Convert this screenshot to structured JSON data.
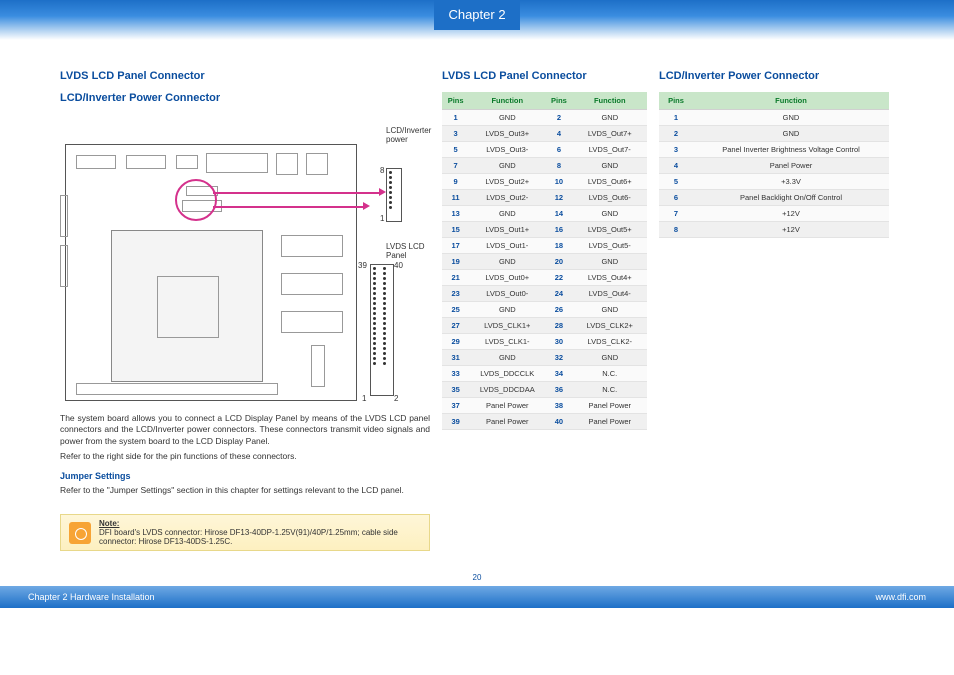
{
  "header": {
    "chapter_tab": "Chapter 2"
  },
  "left": {
    "title1": "LVDS LCD Panel Connector",
    "title2": "LCD/Inverter Power Connector",
    "diagram": {
      "label_inverter": "LCD/Inverter power",
      "label_lvds": "LVDS LCD Panel",
      "pin8": "8",
      "pin1a": "1",
      "pin39": "39",
      "pin40": "40",
      "pin1b": "1",
      "pin2": "2"
    },
    "para1": "The system board allows you to connect a LCD Display Panel by means of the LVDS LCD panel connectors and the LCD/Inverter power connectors. These connectors transmit video signals and power from the system board to the LCD Display Panel.",
    "para2": "Refer to the right side for the pin functions of these connectors.",
    "jumper_head": "Jumper Settings",
    "para3": "Refer to the \"Jumper Settings\" section in this chapter for settings relevant to the LCD panel.",
    "note": {
      "head": "Note:",
      "body": "DFI board's LVDS connector: Hirose DF13-40DP-1.25V(91)/40P/1.25mm; cable side connector: Hirose DF13-40DS-1.25C."
    }
  },
  "mid": {
    "title": "LVDS LCD Panel Connector",
    "headers": [
      "Pins",
      "Function",
      "Pins",
      "Function"
    ],
    "rows": [
      [
        "1",
        "GND",
        "2",
        "GND"
      ],
      [
        "3",
        "LVDS_Out3+",
        "4",
        "LVDS_Out7+"
      ],
      [
        "5",
        "LVDS_Out3-",
        "6",
        "LVDS_Out7-"
      ],
      [
        "7",
        "GND",
        "8",
        "GND"
      ],
      [
        "9",
        "LVDS_Out2+",
        "10",
        "LVDS_Out6+"
      ],
      [
        "11",
        "LVDS_Out2-",
        "12",
        "LVDS_Out6-"
      ],
      [
        "13",
        "GND",
        "14",
        "GND"
      ],
      [
        "15",
        "LVDS_Out1+",
        "16",
        "LVDS_Out5+"
      ],
      [
        "17",
        "LVDS_Out1-",
        "18",
        "LVDS_Out5-"
      ],
      [
        "19",
        "GND",
        "20",
        "GND"
      ],
      [
        "21",
        "LVDS_Out0+",
        "22",
        "LVDS_Out4+"
      ],
      [
        "23",
        "LVDS_Out0-",
        "24",
        "LVDS_Out4-"
      ],
      [
        "25",
        "GND",
        "26",
        "GND"
      ],
      [
        "27",
        "LVDS_CLK1+",
        "28",
        "LVDS_CLK2+"
      ],
      [
        "29",
        "LVDS_CLK1-",
        "30",
        "LVDS_CLK2-"
      ],
      [
        "31",
        "GND",
        "32",
        "GND"
      ],
      [
        "33",
        "LVDS_DDCCLK",
        "34",
        "N.C."
      ],
      [
        "35",
        "LVDS_DDCDAA",
        "36",
        "N.C."
      ],
      [
        "37",
        "Panel Power",
        "38",
        "Panel Power"
      ],
      [
        "39",
        "Panel Power",
        "40",
        "Panel Power"
      ]
    ]
  },
  "right": {
    "title": "LCD/Inverter Power Connector",
    "headers": [
      "Pins",
      "Function"
    ],
    "rows": [
      [
        "1",
        "GND"
      ],
      [
        "2",
        "GND"
      ],
      [
        "3",
        "Panel Inverter Brightness Voltage Control"
      ],
      [
        "4",
        "Panel Power"
      ],
      [
        "5",
        "+3.3V"
      ],
      [
        "6",
        "Panel Backlight On/Off Control"
      ],
      [
        "7",
        "+12V"
      ],
      [
        "8",
        "+12V"
      ]
    ]
  },
  "page_number": "20",
  "footer": {
    "left": "Chapter 2 Hardware Installation",
    "right": "www.dfi.com"
  }
}
